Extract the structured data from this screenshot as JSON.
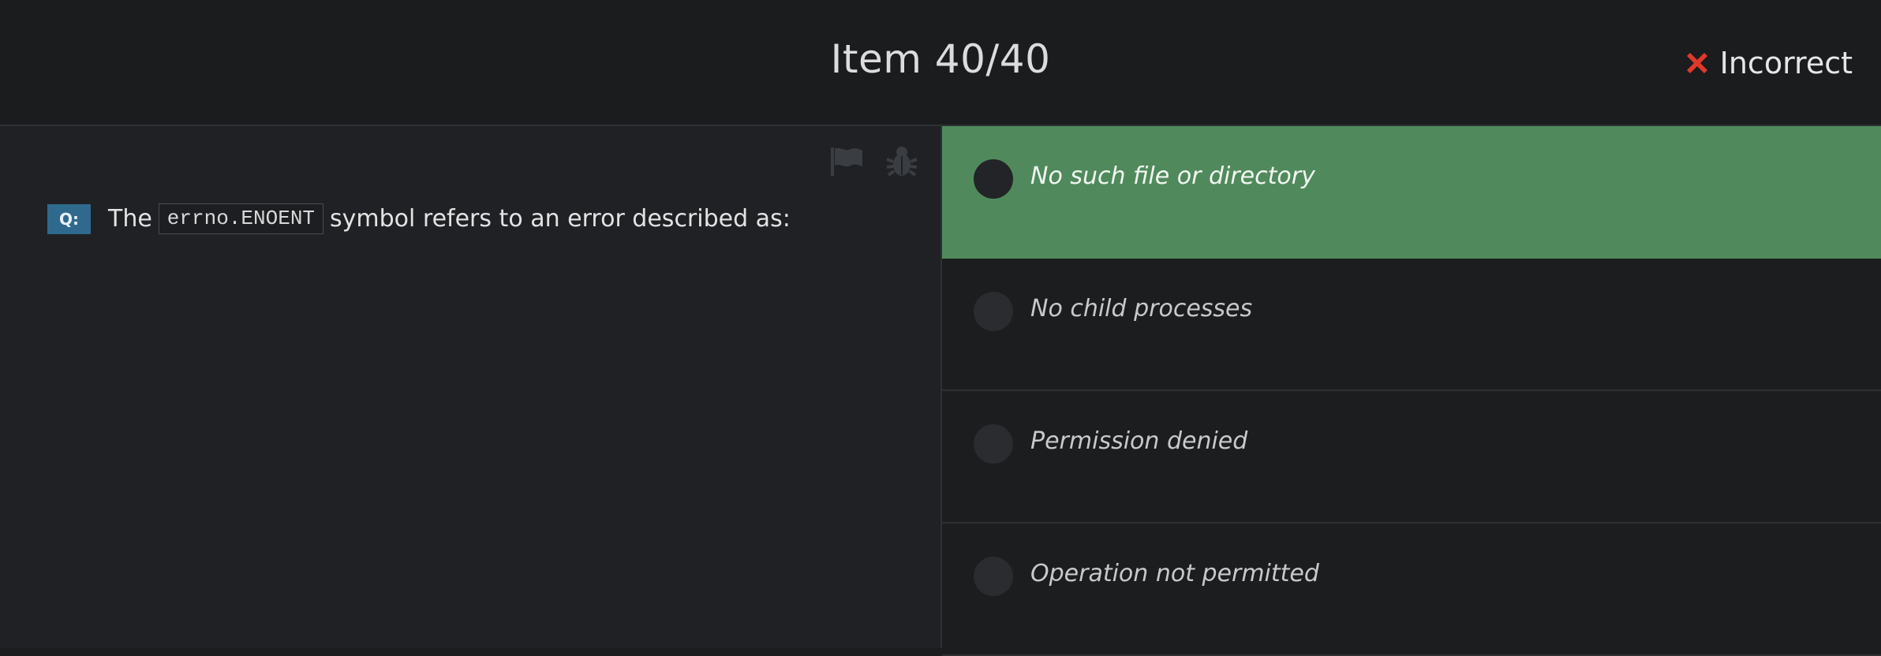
{
  "header": {
    "title": "Item 40/40",
    "status_label": "Incorrect",
    "status_icon": "x-mark-icon",
    "status_color": "#e0392b"
  },
  "question": {
    "badge": "Q:",
    "text_before": "The",
    "code": "errno.ENOENT",
    "text_after": "symbol refers to an error described as:"
  },
  "tools": {
    "flag_icon": "flag-icon",
    "bug_icon": "bug-icon"
  },
  "answers": [
    {
      "label": "No such file or directory",
      "state": "correct"
    },
    {
      "label": "No child processes",
      "state": "default"
    },
    {
      "label": "Permission denied",
      "state": "default"
    },
    {
      "label": "Operation not permitted",
      "state": "default"
    }
  ],
  "colors": {
    "correct_bg": "#508a5c",
    "badge_bg": "#2f6a8e"
  }
}
